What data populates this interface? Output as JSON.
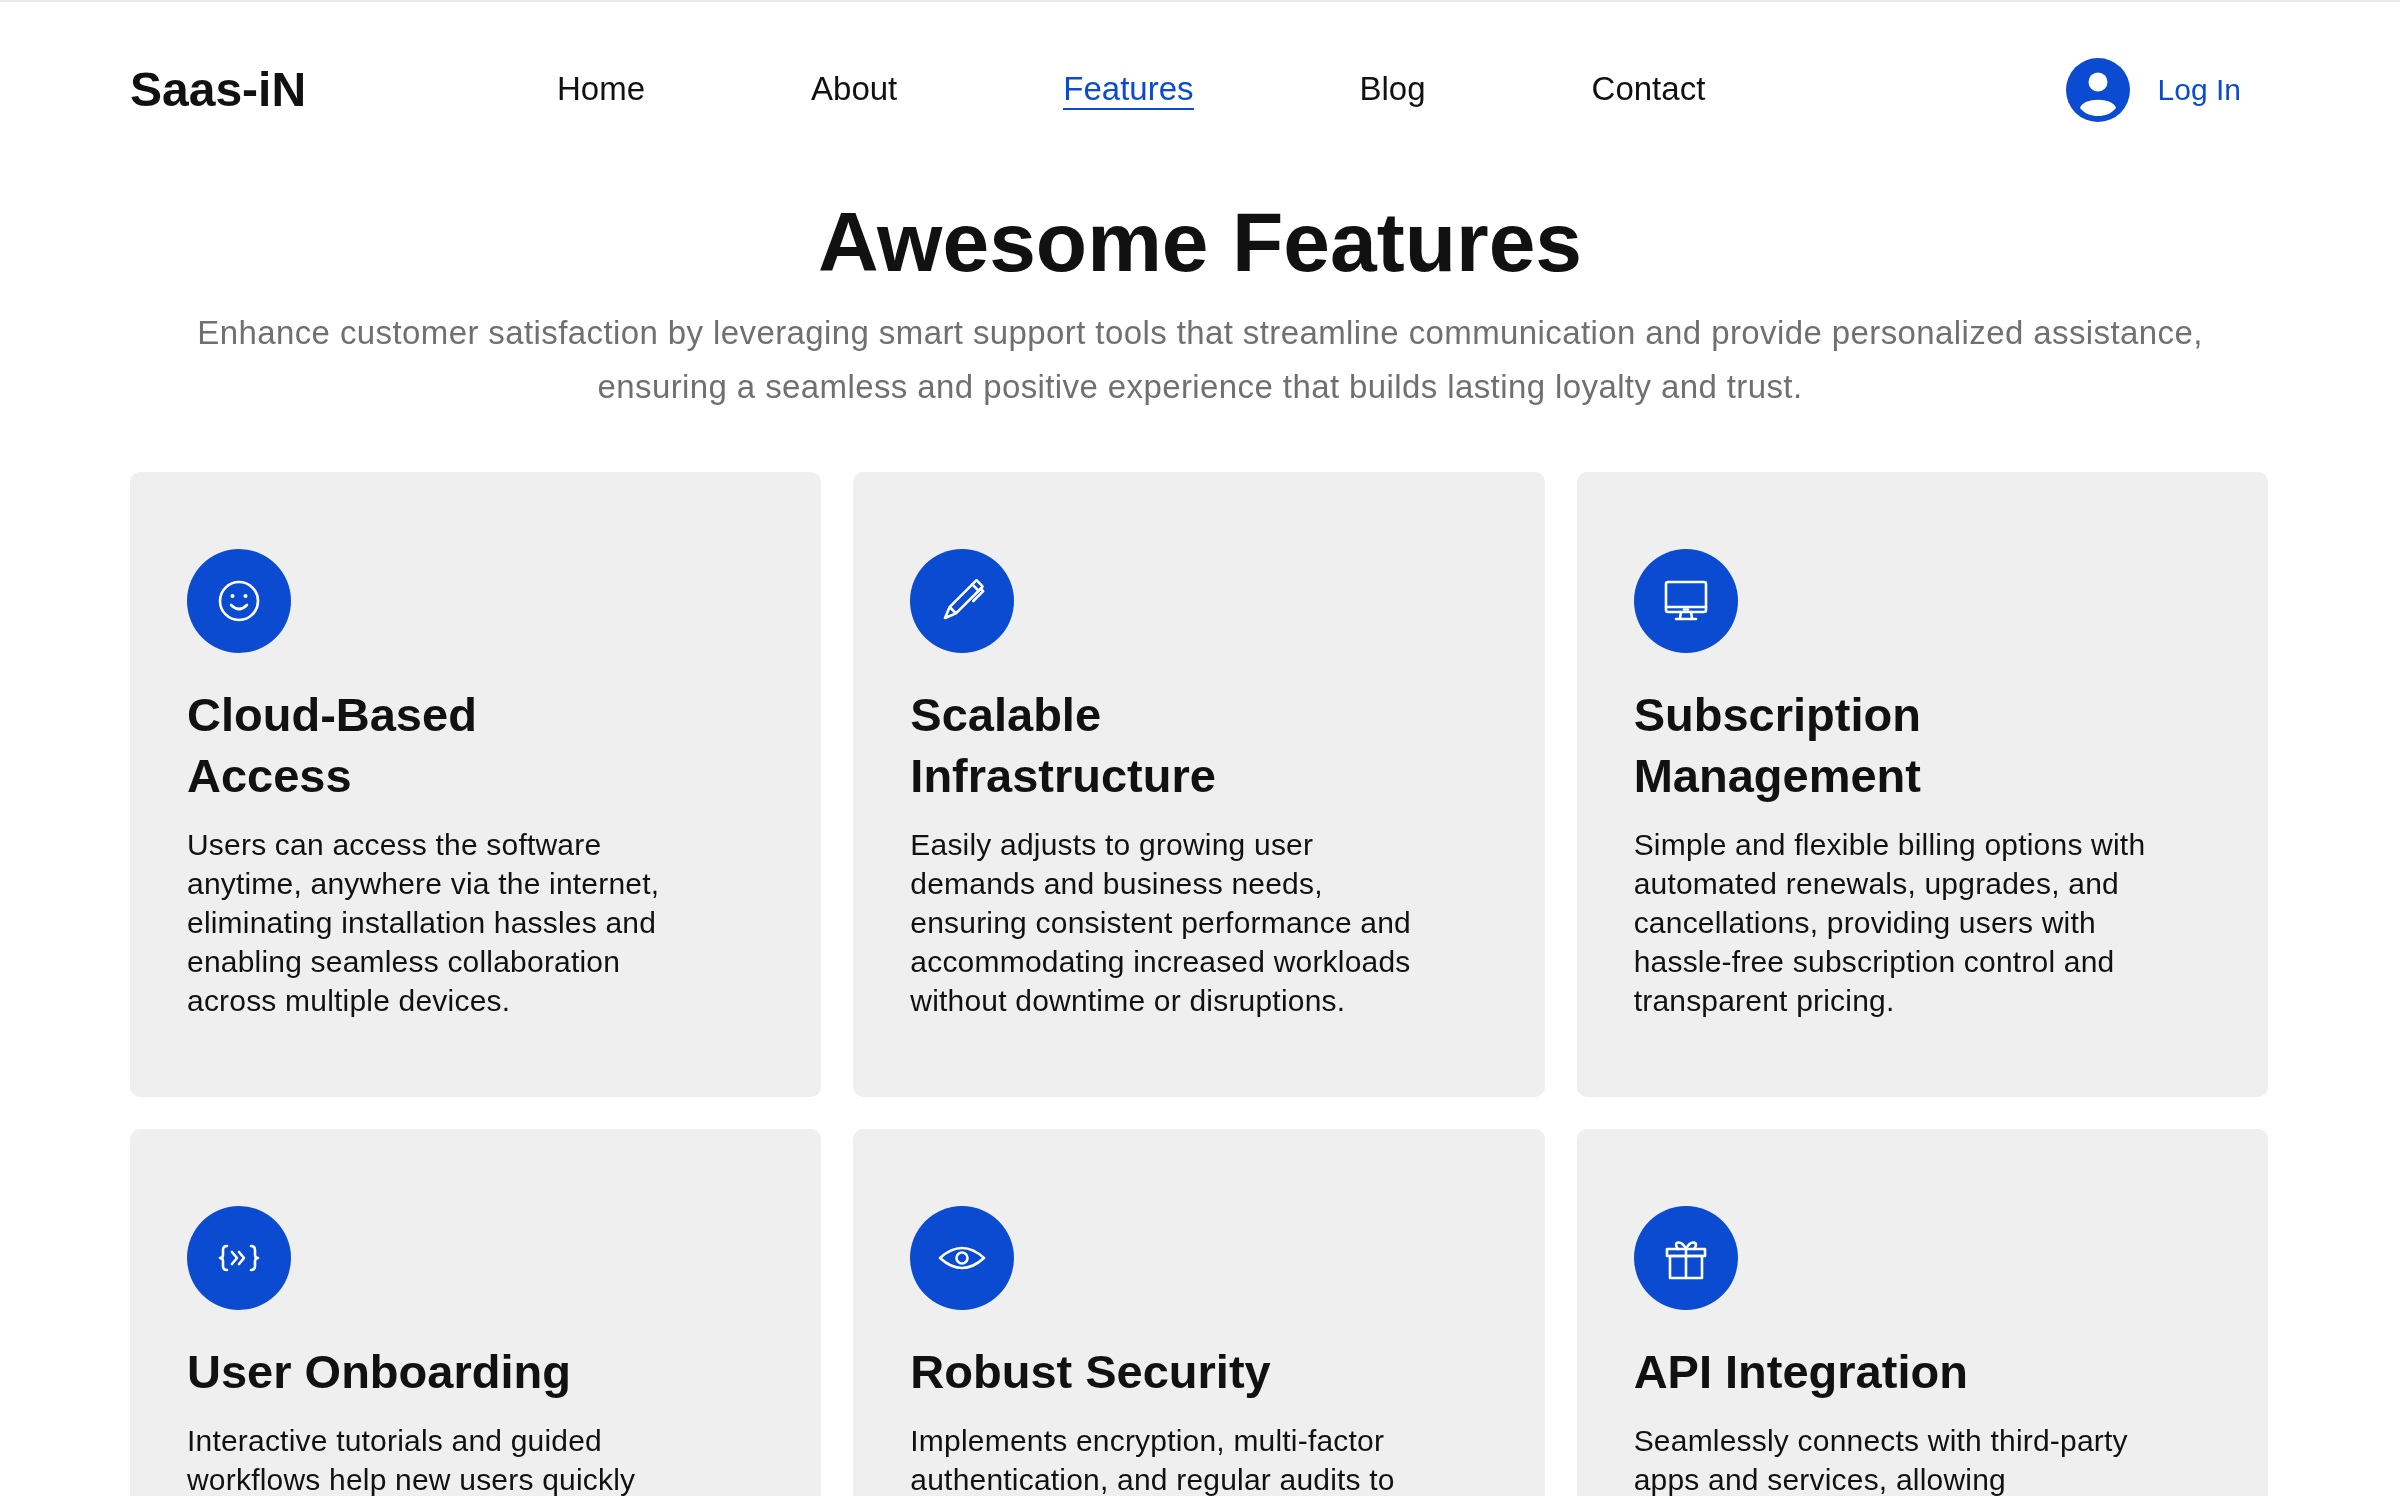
{
  "header": {
    "logo": "Saas-iN",
    "nav": [
      {
        "label": "Home",
        "selected": false
      },
      {
        "label": "About",
        "selected": false
      },
      {
        "label": "Features",
        "selected": true
      },
      {
        "label": "Blog",
        "selected": false
      },
      {
        "label": "Contact",
        "selected": false
      }
    ],
    "login": "Log In"
  },
  "hero": {
    "title": "Awesome Features",
    "subtitle": "Enhance customer satisfaction by leveraging smart support tools that streamline communication and provide personalized assistance, ensuring a seamless and positive experience that builds lasting loyalty and trust."
  },
  "features": [
    {
      "title": "Cloud-Based Access",
      "description": "Users can access the software anytime, anywhere via the internet, eliminating installation hassles and enabling seamless collaboration across multiple devices."
    },
    {
      "title": "Scalable Infrastructure",
      "description": "Easily adjusts to growing user demands and business needs, ensuring consistent performance and accommodating increased workloads without downtime or disruptions."
    },
    {
      "title": "Subscription Management",
      "description": "Simple and flexible billing options with automated renewals, upgrades, and cancellations, providing users with hassle-free subscription control and transparent pricing."
    },
    {
      "title": "User Onboarding",
      "description": "Interactive tutorials and guided workflows help new users quickly"
    },
    {
      "title": "Robust Security",
      "description": "Implements encryption, multi-factor authentication, and regular audits to"
    },
    {
      "title": "API Integration",
      "description": "Seamlessly connects with third-party apps and services, allowing"
    }
  ]
}
